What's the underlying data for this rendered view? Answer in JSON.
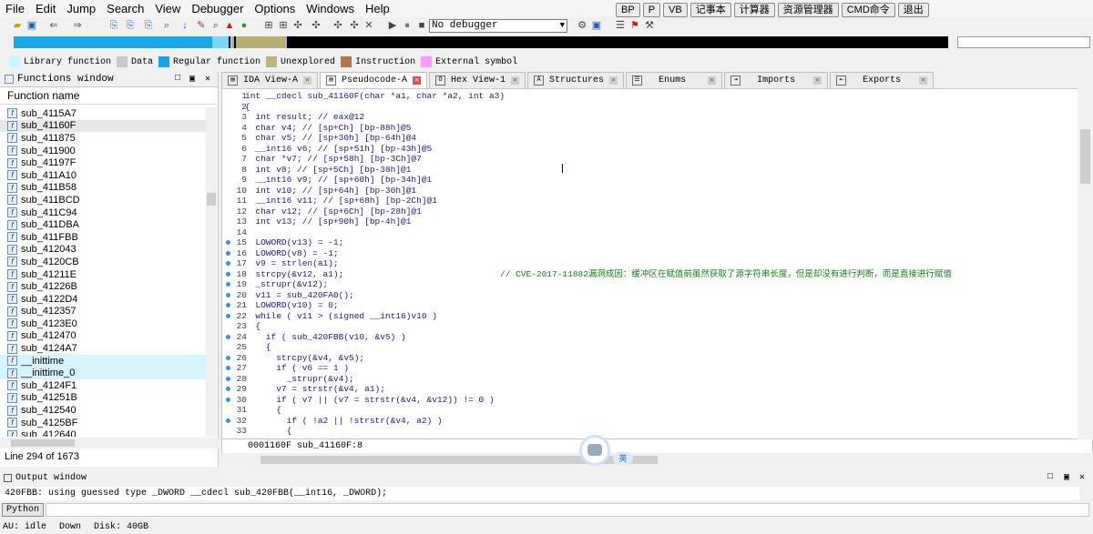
{
  "menu": [
    "File",
    "Edit",
    "Jump",
    "Search",
    "View",
    "Debugger",
    "Options",
    "Windows",
    "Help"
  ],
  "ext_buttons": [
    "BP",
    "P",
    "VB",
    "记事本",
    "计算器",
    "资源管理器",
    "CMD命令",
    "退出"
  ],
  "debugger": {
    "selected": "No debugger"
  },
  "legend": [
    {
      "label": "Library function",
      "color": "#c8f7ff"
    },
    {
      "label": "Data",
      "color": "#c8c8c8"
    },
    {
      "label": "Regular function",
      "color": "#1aa3e8"
    },
    {
      "label": "Unexplored",
      "color": "#bdb580"
    },
    {
      "label": "Instruction",
      "color": "#b5744e"
    },
    {
      "label": "External symbol",
      "color": "#ff99ff"
    }
  ],
  "functions_window": {
    "title": "Functions window",
    "column": "Function name",
    "items": [
      "sub_4115A7",
      "sub_41160F",
      "sub_411875",
      "sub_411900",
      "sub_41197F",
      "sub_411A10",
      "sub_411B58",
      "sub_411BCD",
      "sub_411C94",
      "sub_411DBA",
      "sub_411FBB",
      "sub_412043",
      "sub_4120CB",
      "sub_41211E",
      "sub_41226B",
      "sub_4122D4",
      "sub_412357",
      "sub_4123E0",
      "sub_412470",
      "sub_4124A7",
      "__inittime",
      "__inittime_0",
      "sub_4124F1",
      "sub_41251B",
      "sub_412540",
      "sub_4125BF",
      "sub_412640"
    ],
    "status": "Line 294 of 1673"
  },
  "tabs": [
    "IDA View-A",
    "Pseudocode-A",
    "Hex View-1",
    "Structures",
    "Enums",
    "Imports",
    "Exports"
  ],
  "code": [
    {
      "n": "1",
      "t": "int __cdecl sub_41160F(char *a1, char *a2, int a3)",
      "bp": false
    },
    {
      "n": "2",
      "t": "{",
      "bp": false
    },
    {
      "n": "3",
      "t": "  int result; // eax@12",
      "bp": false
    },
    {
      "n": "4",
      "t": "  char v4; // [sp+Ch] [bp-88h]@5",
      "bp": false
    },
    {
      "n": "5",
      "t": "  char v5; // [sp+30h] [bp-64h]@4",
      "bp": false
    },
    {
      "n": "6",
      "t": "  __int16 v6; // [sp+51h] [bp-43h]@5",
      "bp": false
    },
    {
      "n": "7",
      "t": "  char *v7; // [sp+58h] [bp-3Ch]@7",
      "bp": false
    },
    {
      "n": "8",
      "t": "  int v8; // [sp+5Ch] [bp-38h]@1",
      "bp": false
    },
    {
      "n": "9",
      "t": "  __int16 v9; // [sp+60h] [bp-34h]@1",
      "bp": false
    },
    {
      "n": "10",
      "t": "  int v10; // [sp+64h] [bp-30h]@1",
      "bp": false
    },
    {
      "n": "11",
      "t": "  __int16 v11; // [sp+68h] [bp-2Ch]@1",
      "bp": false
    },
    {
      "n": "12",
      "t": "  char v12; // [sp+6Ch] [bp-28h]@1",
      "bp": false
    },
    {
      "n": "13",
      "t": "  int v13; // [sp+90h] [bp-4h]@1",
      "bp": false
    },
    {
      "n": "14",
      "t": "",
      "bp": false
    },
    {
      "n": "15",
      "t": "  LOWORD(v13) = -1;",
      "bp": true
    },
    {
      "n": "16",
      "t": "  LOWORD(v8) = -1;",
      "bp": true
    },
    {
      "n": "17",
      "t": "  v9 = strlen(a1);",
      "bp": true
    },
    {
      "n": "18",
      "t": "  strcpy(&v12, a1);",
      "bp": true
    },
    {
      "n": "19",
      "t": "  _strupr(&v12);",
      "bp": true
    },
    {
      "n": "20",
      "t": "  v11 = sub_420FA0();",
      "bp": true
    },
    {
      "n": "21",
      "t": "  LOWORD(v10) = 0;",
      "bp": true
    },
    {
      "n": "22",
      "t": "  while ( v11 > (signed __int16)v10 )",
      "bp": true
    },
    {
      "n": "23",
      "t": "  {",
      "bp": false
    },
    {
      "n": "24",
      "t": "    if ( sub_420FBB(v10, &v5) )",
      "bp": true
    },
    {
      "n": "25",
      "t": "    {",
      "bp": false
    },
    {
      "n": "26",
      "t": "      strcpy(&v4, &v5);",
      "bp": true
    },
    {
      "n": "27",
      "t": "      if ( v6 == 1 )",
      "bp": true
    },
    {
      "n": "28",
      "t": "        _strupr(&v4);",
      "bp": true
    },
    {
      "n": "29",
      "t": "      v7 = strstr(&v4, a1);",
      "bp": true
    },
    {
      "n": "30",
      "t": "      if ( v7 || (v7 = strstr(&v4, &v12)) != 0 )",
      "bp": true
    },
    {
      "n": "31",
      "t": "      {",
      "bp": false
    },
    {
      "n": "32",
      "t": "        if ( !a2 || !strstr(&v4, a2) )",
      "bp": true
    },
    {
      "n": "33",
      "t": "        {",
      "bp": false
    }
  ],
  "comment_line18": "// CVE-2017-11882漏洞成因：缓冲区在赋值前虽然获取了源字符串长度，但是却没有进行判断，而是直接进行赋值",
  "code_location": "0001160F sub_41160F:8",
  "output": {
    "title": "Output window",
    "text": "420FBB: using guessed type _DWORD __cdecl sub_420FBB(__int16, _DWORD);",
    "python_label": "Python"
  },
  "status": {
    "au": "AU:  idle",
    "dir": "Down",
    "disk": "Disk: 40GB"
  },
  "ime_badge": "英"
}
